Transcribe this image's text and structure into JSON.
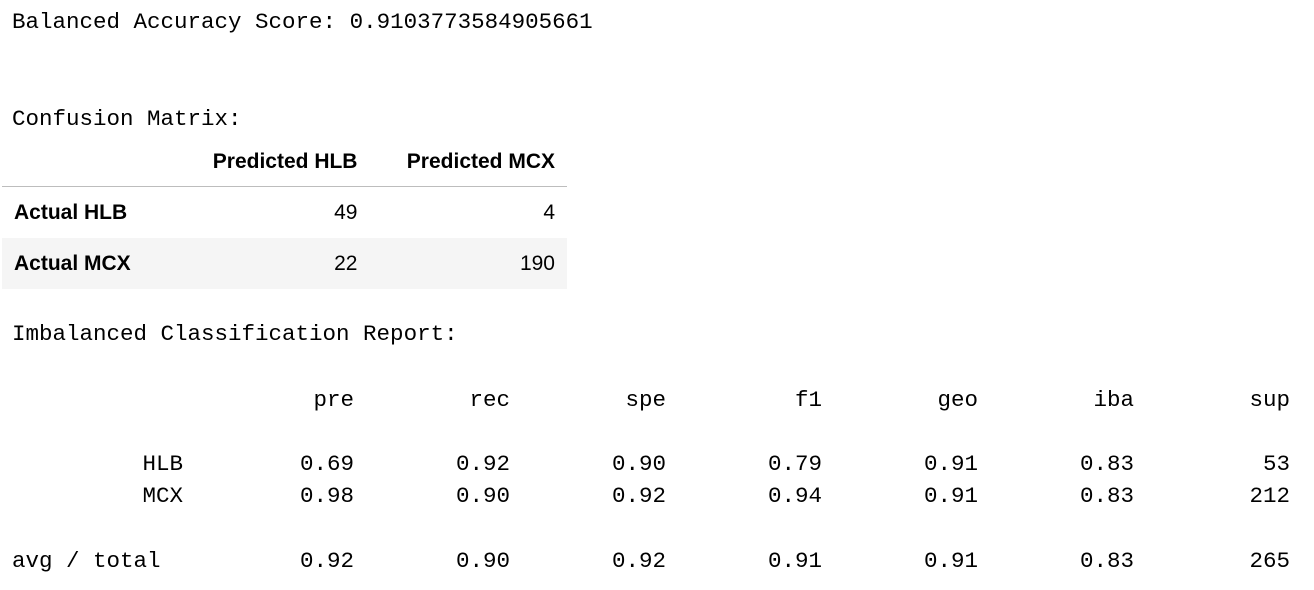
{
  "balanced_accuracy": {
    "label": "Balanced Accuracy Score:",
    "value": "0.9103773584905661"
  },
  "confusion_matrix": {
    "title": "Confusion Matrix:",
    "columns": [
      "Predicted HLB",
      "Predicted MCX"
    ],
    "rows": [
      {
        "label": "Actual HLB",
        "values": [
          "49",
          "4"
        ]
      },
      {
        "label": "Actual MCX",
        "values": [
          "22",
          "190"
        ]
      }
    ]
  },
  "report": {
    "title": "Imbalanced Classification Report:",
    "columns": [
      "pre",
      "rec",
      "spe",
      "f1",
      "geo",
      "iba",
      "sup"
    ],
    "rows": [
      {
        "label": "HLB",
        "values": [
          "0.69",
          "0.92",
          "0.90",
          "0.79",
          "0.91",
          "0.83",
          "53"
        ]
      },
      {
        "label": "MCX",
        "values": [
          "0.98",
          "0.90",
          "0.92",
          "0.94",
          "0.91",
          "0.83",
          "212"
        ]
      },
      {
        "label": "avg / total",
        "values": [
          "0.92",
          "0.90",
          "0.92",
          "0.91",
          "0.91",
          "0.83",
          "265"
        ]
      }
    ]
  }
}
